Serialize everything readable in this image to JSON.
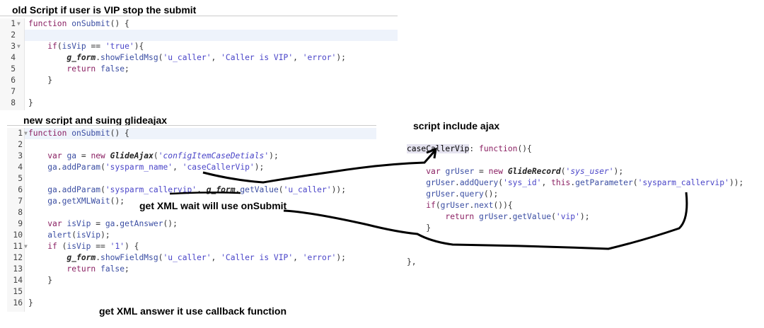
{
  "headings": {
    "old": "old Script if user is VIP stop the submit",
    "new": "new script and suing glideajax",
    "include": "script include ajax"
  },
  "annotations": {
    "wait": "get XML wait will use onSubmit",
    "answer": "get XML answer it use callback function"
  },
  "old_editor": {
    "lines": [
      [
        [
          "k",
          "function "
        ],
        [
          "i",
          "onSubmit"
        ],
        [
          "p",
          "() {"
        ]
      ],
      [],
      [
        [
          "p",
          "    "
        ],
        [
          "k",
          "if"
        ],
        [
          "p",
          "("
        ],
        [
          "i",
          "isVip"
        ],
        [
          "p",
          " == "
        ],
        [
          "s",
          "'true'"
        ],
        [
          "p",
          "){"
        ]
      ],
      [
        [
          "p",
          "        "
        ],
        [
          "g",
          "g_form"
        ],
        [
          "p",
          "."
        ],
        [
          "i",
          "showFieldMsg"
        ],
        [
          "p",
          "("
        ],
        [
          "s",
          "'u_caller'"
        ],
        [
          "p",
          ", "
        ],
        [
          "s",
          "'Caller is VIP'"
        ],
        [
          "p",
          ", "
        ],
        [
          "s",
          "'error'"
        ],
        [
          "p",
          ");"
        ]
      ],
      [
        [
          "p",
          "        "
        ],
        [
          "k",
          "return "
        ],
        [
          "i",
          "false"
        ],
        [
          "p",
          ";"
        ]
      ],
      [
        [
          "p",
          "    }"
        ]
      ],
      [],
      [
        [
          "p",
          "}"
        ]
      ]
    ]
  },
  "new_editor": {
    "lines": [
      [
        [
          "k",
          "function "
        ],
        [
          "i",
          "onSubmit"
        ],
        [
          "p",
          "() {"
        ]
      ],
      [],
      [
        [
          "p",
          "    "
        ],
        [
          "k",
          "var "
        ],
        [
          "i",
          "ga"
        ],
        [
          "p",
          " = "
        ],
        [
          "k",
          "new "
        ],
        [
          "c",
          "GlideAjax"
        ],
        [
          "p",
          "("
        ],
        [
          "cs",
          "'configItemCaseDetials'"
        ],
        [
          "p",
          ");"
        ]
      ],
      [
        [
          "p",
          "    "
        ],
        [
          "i",
          "ga"
        ],
        [
          "p",
          "."
        ],
        [
          "i",
          "addParam"
        ],
        [
          "p",
          "("
        ],
        [
          "s",
          "'sysparm_name'"
        ],
        [
          "p",
          ", "
        ],
        [
          "s",
          "'caseCallerVip'"
        ],
        [
          "p",
          ");"
        ]
      ],
      [],
      [
        [
          "p",
          "    "
        ],
        [
          "i",
          "ga"
        ],
        [
          "p",
          "."
        ],
        [
          "i",
          "addParam"
        ],
        [
          "p",
          "("
        ],
        [
          "s",
          "'sysparm_callervip'"
        ],
        [
          "p",
          ", "
        ],
        [
          "g",
          "g_form"
        ],
        [
          "p",
          "."
        ],
        [
          "i",
          "getValue"
        ],
        [
          "p",
          "("
        ],
        [
          "s",
          "'u_caller'"
        ],
        [
          "p",
          "));"
        ]
      ],
      [
        [
          "p",
          "    "
        ],
        [
          "i",
          "ga"
        ],
        [
          "p",
          "."
        ],
        [
          "i",
          "getXMLWait"
        ],
        [
          "p",
          "();"
        ]
      ],
      [],
      [
        [
          "p",
          "    "
        ],
        [
          "k",
          "var "
        ],
        [
          "i",
          "isVip"
        ],
        [
          "p",
          " = "
        ],
        [
          "i",
          "ga"
        ],
        [
          "p",
          "."
        ],
        [
          "i",
          "getAnswer"
        ],
        [
          "p",
          "();"
        ]
      ],
      [
        [
          "p",
          "    "
        ],
        [
          "i",
          "alert"
        ],
        [
          "p",
          "("
        ],
        [
          "i",
          "isVip"
        ],
        [
          "p",
          ");"
        ]
      ],
      [
        [
          "p",
          "    "
        ],
        [
          "k",
          "if"
        ],
        [
          "p",
          " ("
        ],
        [
          "i",
          "isVip"
        ],
        [
          "p",
          " == "
        ],
        [
          "s",
          "'1'"
        ],
        [
          "p",
          ") {"
        ]
      ],
      [
        [
          "p",
          "        "
        ],
        [
          "g",
          "g_form"
        ],
        [
          "p",
          "."
        ],
        [
          "i",
          "showFieldMsg"
        ],
        [
          "p",
          "("
        ],
        [
          "s",
          "'u_caller'"
        ],
        [
          "p",
          ", "
        ],
        [
          "s",
          "'Caller is VIP'"
        ],
        [
          "p",
          ", "
        ],
        [
          "s",
          "'error'"
        ],
        [
          "p",
          ");"
        ]
      ],
      [
        [
          "p",
          "        "
        ],
        [
          "k",
          "return "
        ],
        [
          "i",
          "false"
        ],
        [
          "p",
          ";"
        ]
      ],
      [
        [
          "p",
          "    }"
        ]
      ],
      [],
      [
        [
          "p",
          "}"
        ]
      ]
    ]
  },
  "include_code": {
    "lines": [
      [
        [
          "hl",
          "caseCallerVip"
        ],
        [
          "p",
          ": "
        ],
        [
          "k",
          "function"
        ],
        [
          "p",
          "(){"
        ]
      ],
      [],
      [
        [
          "p",
          "    "
        ],
        [
          "k",
          "var "
        ],
        [
          "i",
          "grUser"
        ],
        [
          "p",
          " = "
        ],
        [
          "k",
          "new "
        ],
        [
          "c",
          "GlideRecord"
        ],
        [
          "p",
          "("
        ],
        [
          "cs",
          "'sys_user'"
        ],
        [
          "p",
          ");"
        ]
      ],
      [
        [
          "p",
          "    "
        ],
        [
          "i",
          "grUser"
        ],
        [
          "p",
          "."
        ],
        [
          "i",
          "addQuery"
        ],
        [
          "p",
          "("
        ],
        [
          "s",
          "'sys_id'"
        ],
        [
          "p",
          ", "
        ],
        [
          "k",
          "this"
        ],
        [
          "p",
          "."
        ],
        [
          "i",
          "getParameter"
        ],
        [
          "p",
          "("
        ],
        [
          "s",
          "'sysparm_callervip'"
        ],
        [
          "p",
          "));"
        ]
      ],
      [
        [
          "p",
          "    "
        ],
        [
          "i",
          "grUser"
        ],
        [
          "p",
          "."
        ],
        [
          "i",
          "query"
        ],
        [
          "p",
          "();"
        ]
      ],
      [
        [
          "p",
          "    "
        ],
        [
          "k",
          "if"
        ],
        [
          "p",
          "("
        ],
        [
          "i",
          "grUser"
        ],
        [
          "p",
          "."
        ],
        [
          "i",
          "next"
        ],
        [
          "p",
          "()){"
        ]
      ],
      [
        [
          "p",
          "        "
        ],
        [
          "k",
          "return "
        ],
        [
          "i",
          "grUser"
        ],
        [
          "p",
          "."
        ],
        [
          "i",
          "getValue"
        ],
        [
          "p",
          "("
        ],
        [
          "s",
          "'vip'"
        ],
        [
          "p",
          ");"
        ]
      ],
      [
        [
          "p",
          "    }"
        ]
      ],
      [],
      [],
      [
        [
          "p",
          "},"
        ]
      ]
    ]
  }
}
